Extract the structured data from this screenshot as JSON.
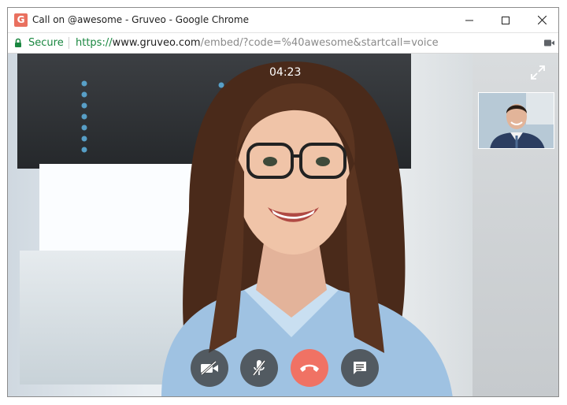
{
  "window": {
    "title": "Call on @awesome - Gruveo - Google Chrome",
    "app_icon_letter": "G"
  },
  "address_bar": {
    "secure_label": "Secure",
    "url_scheme": "https://",
    "url_host": "www.gruveo.com",
    "url_path": "/embed/?code=%40awesome&startcall=voice"
  },
  "call": {
    "timer": "04:23"
  },
  "colors": {
    "hangup": "#f07264",
    "secure_green": "#1a8740",
    "control_bg": "#3c3c3c"
  },
  "icons": {
    "minimize": "minimize-icon",
    "maximize": "maximize-icon",
    "close": "close-icon",
    "lock": "lock-icon",
    "camera_indicator": "video-camera-icon",
    "fullscreen": "expand-icon",
    "camera_off": "camera-off-icon",
    "mic_off": "mic-off-icon",
    "hangup": "phone-hangup-icon",
    "chat": "chat-icon"
  }
}
